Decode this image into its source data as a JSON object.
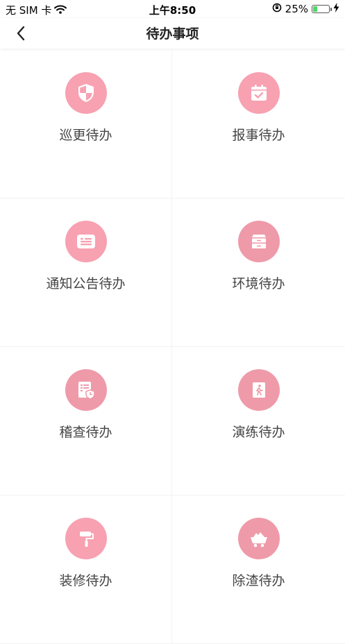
{
  "status_bar": {
    "carrier": "无 SIM 卡",
    "time": "上午8:50",
    "battery_percent": "25%",
    "battery_level": 0.25
  },
  "nav": {
    "title": "待办事项"
  },
  "colors": {
    "icon_pink": "#f7a1b1",
    "icon_pink_alt": "#ef9aa9",
    "divider": "#f2f2f2",
    "label_text": "#444444"
  },
  "items": [
    {
      "label": "巡更待办",
      "icon": "shield-icon"
    },
    {
      "label": "报事待办",
      "icon": "calendar-check-icon"
    },
    {
      "label": "通知公告待办",
      "icon": "message-icon"
    },
    {
      "label": "环境待办",
      "icon": "cabinet-icon"
    },
    {
      "label": "稽查待办",
      "icon": "document-shield-icon"
    },
    {
      "label": "演练待办",
      "icon": "emergency-exit-icon"
    },
    {
      "label": "装修待办",
      "icon": "paint-roller-icon"
    },
    {
      "label": "除渣待办",
      "icon": "mine-cart-icon"
    }
  ]
}
